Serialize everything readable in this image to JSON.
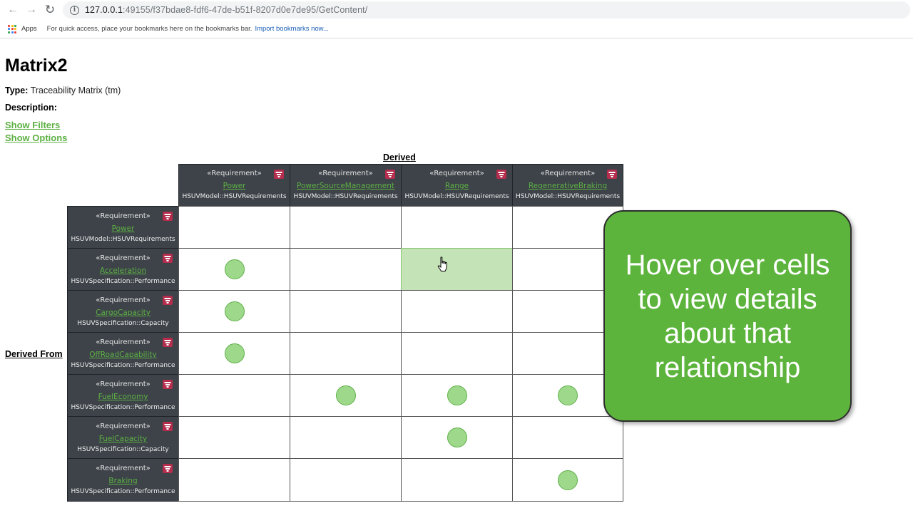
{
  "browser": {
    "url_host": "127.0.0.1",
    "url_rest": ":49155/f37bdae8-fdf6-47de-b51f-8207d0e7de95/GetContent/",
    "bookmarks": {
      "apps_label": "Apps",
      "hint": "For quick access, place your bookmarks here on the bookmarks bar.",
      "import_link": "Import bookmarks now..."
    }
  },
  "page": {
    "title": "Matrix2",
    "type_label": "Type:",
    "type_value": "Traceability Matrix (tm)",
    "description_label": "Description:",
    "show_filters": "Show Filters",
    "show_options": "Show Options"
  },
  "matrix": {
    "column_axis_label": "Derived",
    "row_axis_label": "Derived From",
    "columns": [
      {
        "stereotype": "«Requirement»",
        "name": "Power",
        "path": "HSUVModel::HSUVRequirements"
      },
      {
        "stereotype": "«Requirement»",
        "name": "PowerSourceManagement",
        "path": "HSUVModel::HSUVRequirements"
      },
      {
        "stereotype": "«Requirement»",
        "name": "Range",
        "path": "HSUVModel::HSUVRequirements"
      },
      {
        "stereotype": "«Requirement»",
        "name": "RegenerativeBraking",
        "path": "HSUVModel::HSUVRequirements"
      }
    ],
    "rows": [
      {
        "stereotype": "«Requirement»",
        "name": "Power",
        "path": "HSUVModel::HSUVRequirements"
      },
      {
        "stereotype": "«Requirement»",
        "name": "Acceleration",
        "path": "HSUVSpecification::Performance"
      },
      {
        "stereotype": "«Requirement»",
        "name": "CargoCapacity",
        "path": "HSUVSpecification::Capacity"
      },
      {
        "stereotype": "«Requirement»",
        "name": "OffRoadCapability",
        "path": "HSUVSpecification::Performance"
      },
      {
        "stereotype": "«Requirement»",
        "name": "FuelEconomy",
        "path": "HSUVSpecification::Performance"
      },
      {
        "stereotype": "«Requirement»",
        "name": "FuelCapacity",
        "path": "HSUVSpecification::Capacity"
      },
      {
        "stereotype": "«Requirement»",
        "name": "Braking",
        "path": "HSUVSpecification::Performance"
      }
    ],
    "relations": [
      [
        false,
        false,
        false,
        false
      ],
      [
        true,
        false,
        false,
        false
      ],
      [
        true,
        false,
        false,
        false
      ],
      [
        true,
        false,
        false,
        false
      ],
      [
        false,
        true,
        true,
        true
      ],
      [
        false,
        false,
        true,
        false
      ],
      [
        false,
        false,
        false,
        true
      ]
    ],
    "hovered_cell": {
      "row": 1,
      "col": 2
    },
    "colors": {
      "header_bg": "#3d4349",
      "link_green": "#5db044",
      "dot_fill": "#9ed88a",
      "hover_fill": "#c4e3b6",
      "filter_button": "#b52c4c"
    }
  },
  "callout": {
    "text": "Hover over cells to view details about that relationship",
    "color": "#5cb43c"
  }
}
